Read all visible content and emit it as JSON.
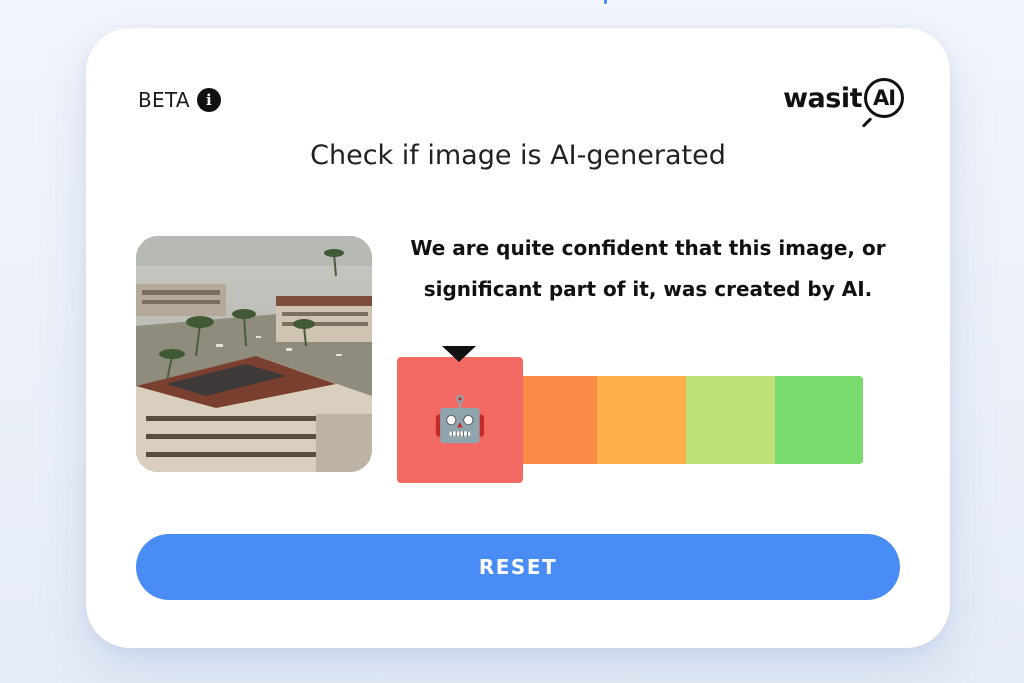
{
  "header": {
    "beta_label": "BETA",
    "info_icon": "info-icon",
    "logo_text": "wasit",
    "logo_badge": "AI"
  },
  "headline": "Check if image is AI-generated",
  "result": {
    "verdict_line1": "We are quite confident that this image, or",
    "verdict_line2": "significant part of it, was created by AI.",
    "meter_level": 1,
    "meter_levels": 5,
    "indicator_icon": "robot-emoji",
    "indicator_glyph": "🤖"
  },
  "meter_colors": [
    "#f26a63",
    "#fb8c47",
    "#fdae47",
    "#bde077",
    "#78da6f"
  ],
  "reset_label": "RESET",
  "colors": {
    "accent": "#4a8cf5",
    "card_bg": "#ffffff"
  }
}
